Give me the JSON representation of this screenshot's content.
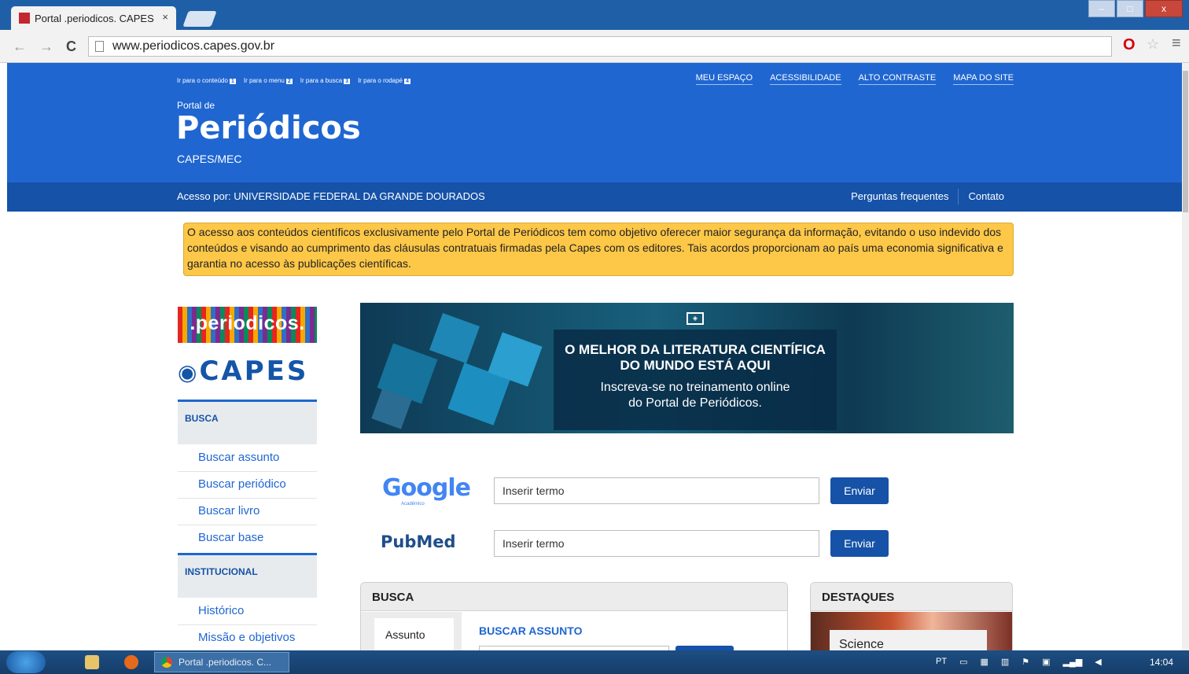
{
  "browser": {
    "tab_title": "Portal .periodicos. CAPES",
    "tab_close": "×",
    "url": "www.periodicos.capes.gov.br",
    "controls": {
      "minimize": "–",
      "maximize": "□",
      "close": "x"
    }
  },
  "header": {
    "skip_links": [
      {
        "label": "Ir para o conteúdo",
        "num": "1"
      },
      {
        "label": "Ir para o menu",
        "num": "2"
      },
      {
        "label": "Ir para a busca",
        "num": "3"
      },
      {
        "label": "Ir para o rodapé",
        "num": "4"
      }
    ],
    "top_menu": [
      "MEU ESPAÇO",
      "ACESSIBILIDADE",
      "ALTO CONTRASTE",
      "MAPA DO SITE"
    ],
    "portal_de": "Portal de",
    "title": "Periódicos",
    "subtitle": "CAPES/MEC"
  },
  "subbar": {
    "access": "Acesso por: UNIVERSIDADE FEDERAL DA GRANDE DOURADOS",
    "faq": "Perguntas frequentes",
    "contact": "Contato"
  },
  "notice": "O acesso aos conteúdos científicos exclusivamente pelo Portal de Periódicos tem como objetivo oferecer maior segurança da informação, evitando o uso indevido dos conteúdos e visando ao cumprimento das cláusulas contratuais firmadas pela Capes com os editores. Tais acordos proporcionam ao país uma economia significativa e garantia no acesso às publicações científicas.",
  "sidebar": {
    "logo_periodicos": ".periodicos.",
    "logo_capes": "CAPES",
    "busca_heading": "BUSCA",
    "busca_items": [
      "Buscar assunto",
      "Buscar periódico",
      "Buscar livro",
      "Buscar base"
    ],
    "inst_heading": "INSTITUCIONAL",
    "inst_items": [
      "Histórico",
      "Missão e objetivos"
    ]
  },
  "banner": {
    "headline_1": "O MELHOR DA LITERATURA CIENTÍFICA",
    "headline_2": "DO MUNDO ESTÁ AQUI",
    "sub_1": "Inscreva-se no treinamento online",
    "sub_2": "do Portal de Periódicos."
  },
  "search": {
    "google_logo": "Google",
    "google_sub": "Acadêmico",
    "pubmed_logo": "PubMed",
    "placeholder": "Inserir termo",
    "send_label": "Enviar"
  },
  "busca_box": {
    "heading": "BUSCA",
    "tab": "Assunto",
    "title": "BUSCAR ASSUNTO"
  },
  "destaques": {
    "heading": "DESTAQUES",
    "caption": "Science"
  },
  "taskbar": {
    "chrome_task": "Portal .periodicos. C...",
    "lang": "PT",
    "clock": "14:04"
  },
  "colors": {
    "header_blue": "#1f66d1",
    "subbar_blue": "#1552a8",
    "notice_yellow": "#fdc748",
    "button_blue": "#1552a8"
  }
}
